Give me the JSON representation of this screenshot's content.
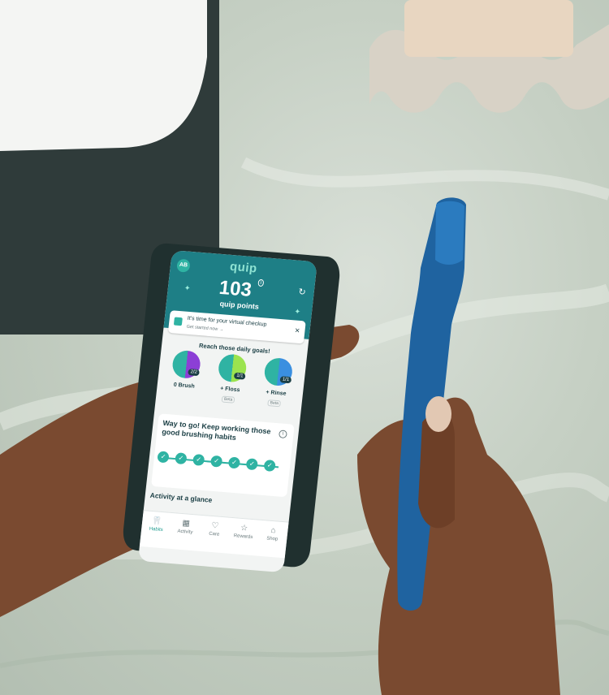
{
  "app": {
    "avatar_initials": "AB",
    "logo": "quip",
    "points_value": "103",
    "points_info": "i",
    "points_label": "quip points",
    "refresh_icon": "refresh-icon",
    "banner_title": "It's time for your virtual checkup",
    "banner_sub": "Get started now →",
    "banner_close": "✕",
    "goals_title": "Reach those daily goals!",
    "goals": [
      {
        "label": "0 Brush",
        "badge": "2/2",
        "beta": ""
      },
      {
        "label": "+ Floss",
        "badge": "1/1",
        "beta": "Beta"
      },
      {
        "label": "+ Rinse",
        "badge": "1/1",
        "beta": "Beta"
      }
    ],
    "card_title": "Way to go! Keep working those good brushing habits",
    "card_info": "i",
    "checks": [
      "✓",
      "✓",
      "✓",
      "✓",
      "✓",
      "✓",
      "✓"
    ],
    "activity_title": "Activity at a glance",
    "tabs": [
      "Habits",
      "Activity",
      "Care",
      "Rewards",
      "Shop"
    ],
    "active_tab": "Habits"
  },
  "colors": {
    "teal_header": "#1e7f86",
    "accent": "#2fb3a3",
    "toothbrush": "#1f63a0",
    "marble": "#c6d0c4",
    "skin": "#7a4a30"
  }
}
